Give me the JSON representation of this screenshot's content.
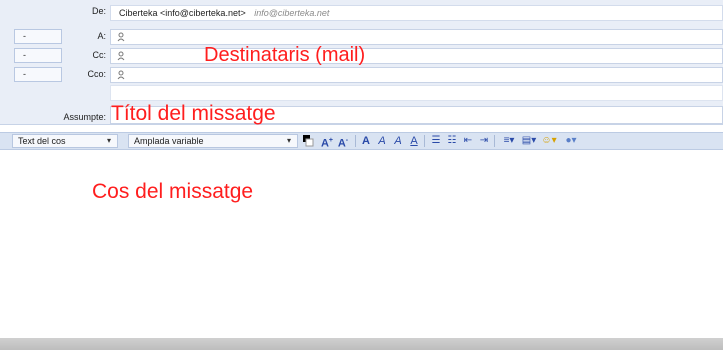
{
  "header": {
    "from_label": "De:",
    "from_value": "Ciberteka <info@ciberteka.net>",
    "from_hint": "info@ciberteka.net",
    "rows": [
      {
        "dropdown": "-",
        "label": "A:"
      },
      {
        "dropdown": "-",
        "label": "Cc:"
      },
      {
        "dropdown": "-",
        "label": "Cco:"
      }
    ],
    "subject_label": "Assumpte:"
  },
  "annotations": {
    "recipients": "Destinataris (mail)",
    "subject": "Títol del missatge",
    "body": "Cos del missatge"
  },
  "toolbar": {
    "style_select": "Text del cos",
    "font_select": "Amplada variable",
    "icons": [
      "color-swatch-icon",
      "font-size-increase-icon",
      "font-size-decrease-icon",
      "bold-icon",
      "italic-icon",
      "italic-alt-icon",
      "underline-icon",
      "bullet-list-icon",
      "numbered-list-icon",
      "decrease-indent-icon",
      "increase-indent-icon",
      "align-icon",
      "insert-table-icon",
      "emoji-icon",
      "insert-link-icon"
    ]
  },
  "colors": {
    "header_bg": "#e9eef7",
    "annotation_red": "#ff1e1e",
    "toolbar_bg": "#d9e3f2"
  }
}
